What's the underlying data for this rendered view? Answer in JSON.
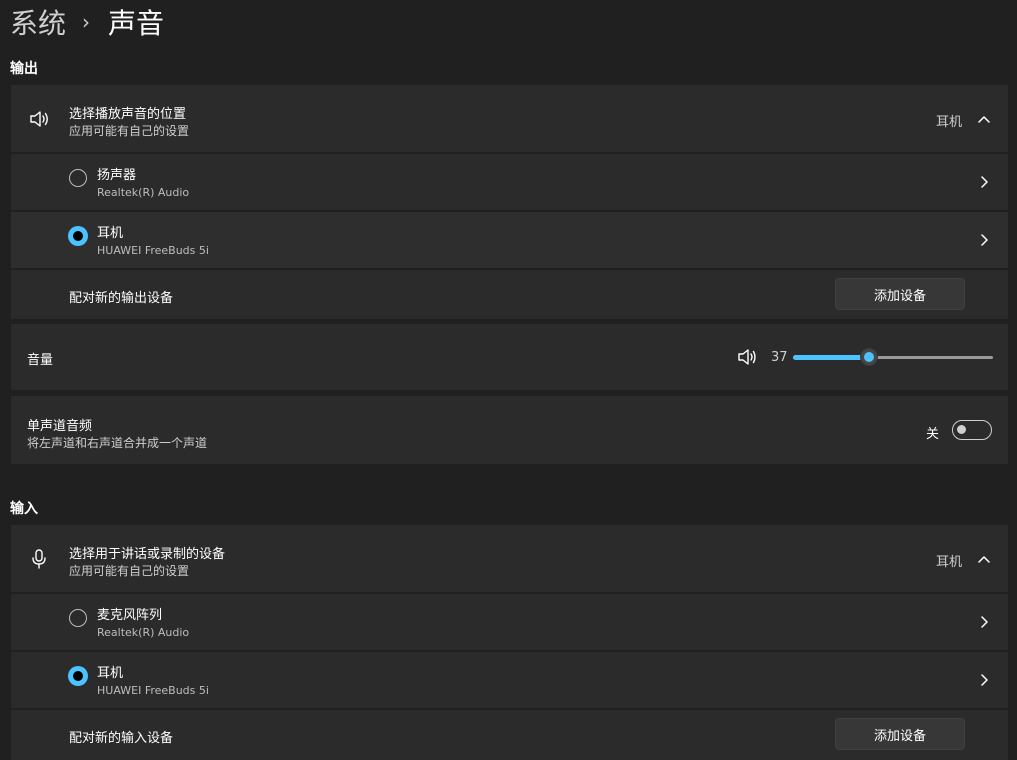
{
  "breadcrumb": {
    "parent": "系统",
    "separator": "›",
    "current": "声音"
  },
  "output": {
    "section_title": "输出",
    "choose": {
      "title": "选择播放声音的位置",
      "subtitle": "应用可能有自己的设置",
      "selected_value": "耳机"
    },
    "devices": [
      {
        "name": "扬声器",
        "detail": "Realtek(R) Audio",
        "selected": false
      },
      {
        "name": "耳机",
        "detail": "HUAWEI FreeBuds 5i",
        "selected": true
      }
    ],
    "pair": {
      "label": "配对新的输出设备",
      "button": "添加设备"
    },
    "volume": {
      "label": "音量",
      "value": "37",
      "level": 37,
      "max": 100
    },
    "mono": {
      "title": "单声道音频",
      "subtitle": "将左声道和右声道合并成一个声道",
      "state": "关"
    }
  },
  "input": {
    "section_title": "输入",
    "choose": {
      "title": "选择用于讲话或录制的设备",
      "subtitle": "应用可能有自己的设置",
      "selected_value": "耳机"
    },
    "devices": [
      {
        "name": "麦克风阵列",
        "detail": "Realtek(R) Audio",
        "selected": false
      },
      {
        "name": "耳机",
        "detail": "HUAWEI FreeBuds 5i",
        "selected": true
      }
    ],
    "pair": {
      "label": "配对新的输入设备",
      "button": "添加设备"
    }
  },
  "colors": {
    "accent": "#4cc2ff",
    "background": "#202020",
    "card": "#2b2b2b"
  }
}
